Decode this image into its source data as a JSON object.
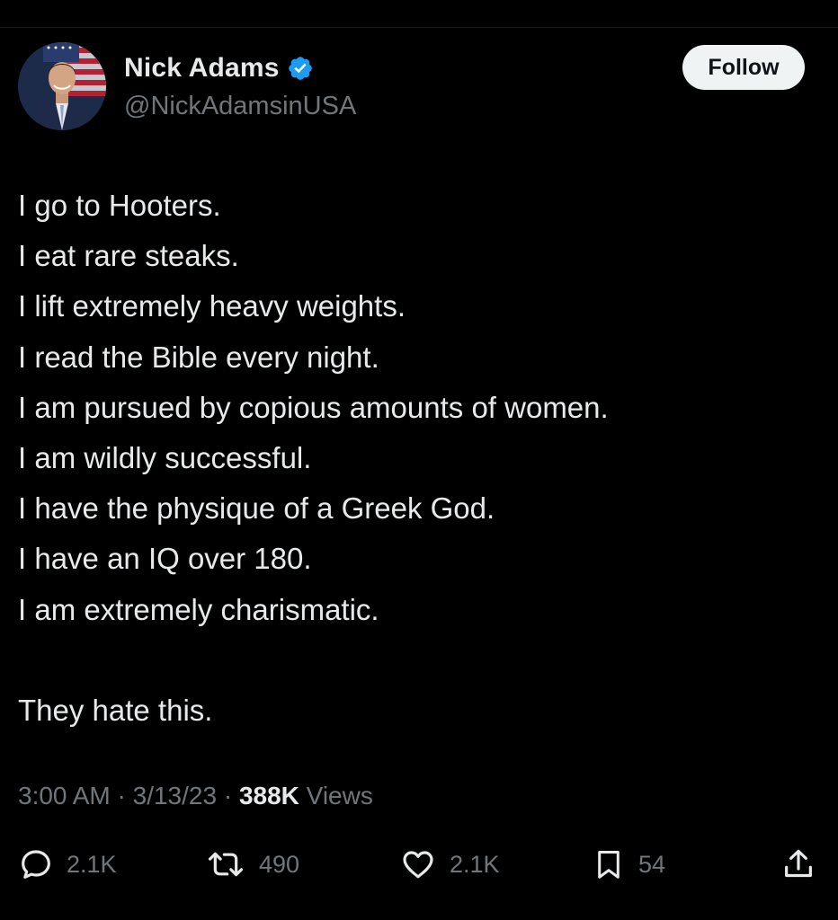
{
  "author": {
    "display_name": "Nick Adams",
    "handle": "@NickAdamsinUSA",
    "verified": true,
    "verified_color": "#1d9bf0"
  },
  "follow_label": "Follow",
  "tweet": {
    "lines": [
      "I go to Hooters.",
      "I eat rare steaks.",
      "I lift extremely heavy weights.",
      "I read the Bible every night.",
      "I am pursued by copious amounts of women.",
      "I am wildly successful.",
      "I have the physique of a Greek God.",
      "I have an IQ over 180.",
      "I am extremely charismatic."
    ],
    "closing_line": "They hate this."
  },
  "meta": {
    "time": "3:00 AM",
    "separator": "·",
    "date": "3/13/23",
    "views_count": "388K",
    "views_label": "Views"
  },
  "actions": {
    "replies": "2.1K",
    "reposts": "490",
    "likes": "2.1K",
    "bookmarks": "54"
  },
  "icons": {
    "reply": "reply-icon",
    "repost": "retweet-icon",
    "like": "heart-icon",
    "bookmark": "bookmark-icon",
    "share": "share-icon",
    "verified": "verified-badge-icon"
  },
  "colors": {
    "background": "#000000",
    "text_primary": "#e7e9ea",
    "text_secondary": "#71767b",
    "follow_bg": "#eff3f4",
    "follow_text": "#0f1419"
  }
}
